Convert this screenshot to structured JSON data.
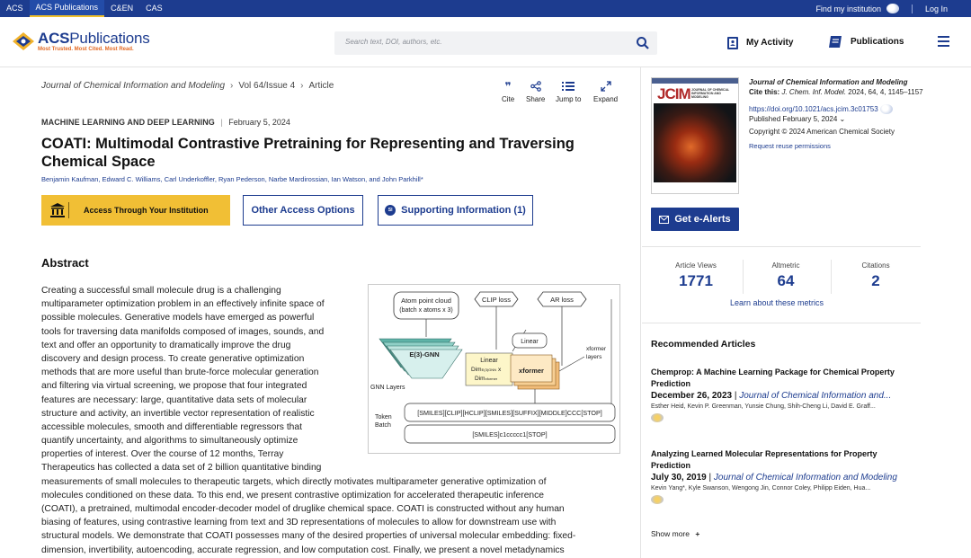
{
  "topbar": {
    "links": [
      "ACS",
      "ACS Publications",
      "C&EN",
      "CAS"
    ],
    "find_institution": "Find my institution",
    "login": "Log In"
  },
  "header": {
    "logo_main": "Publications",
    "logo_prefix": "ACS",
    "logo_tagline": "Most Trusted. Most Cited. Most Read.",
    "search_placeholder": "Search text, DOI, authors, etc.",
    "my_activity": "My Activity",
    "publications": "Publications"
  },
  "breadcrumb": {
    "journal": "Journal of Chemical Information and Modeling",
    "issue": "Vol 64/Issue 4",
    "current": "Article"
  },
  "tools": [
    "Cite",
    "Share",
    "Jump to",
    "Expand"
  ],
  "article": {
    "section": "MACHINE LEARNING AND DEEP LEARNING",
    "date": "February 5, 2024",
    "title": "COATI: Multimodal Contrastive Pretraining for Representing and Traversing Chemical Space",
    "authors": "Benjamin Kaufman,   Edward C. Williams,   Carl Underkoffler,   Ryan Pederson,   Narbe Mardirossian,   Ian Watson,   and  John Parkhill*"
  },
  "buttons": {
    "access": "Access Through Your Institution",
    "other_access": "Other Access Options",
    "supporting": "Supporting Information (1)",
    "si_badge": "SI"
  },
  "abstract": {
    "heading": "Abstract",
    "lines": [
      "Creating a successful small molecule drug is a challenging",
      "multiparameter optimization problem in an effectively infinite space of",
      "possible molecules. Generative models have emerged as powerful",
      "tools for traversing data manifolds composed of images, sounds, and",
      "text and offer an opportunity to dramatically improve the drug",
      "discovery and design process. To create generative optimization",
      "methods that are more useful than brute-force molecular generation",
      "and filtering via virtual screening, we propose that four integrated",
      "features are necessary: large, quantitative data sets of molecular",
      "structure and activity, an invertible vector representation of realistic",
      "accessible molecules, smooth and differentiable regressors that",
      "quantify uncertainty, and algorithms to simultaneously optimize",
      "properties of interest. Over the course of 12 months, Terray",
      "Therapeutics has collected a data set of 2 billion quantitative binding",
      "measurements of small molecules to therapeutic targets, which directly motivates multiparameter generative optimization of",
      "molecules conditioned on these data. To this end, we present contrastive optimization for accelerated therapeutic inference",
      "(COATI), a pretrained, multimodal encoder-decoder model of druglike chemical space. COATI is constructed without any human",
      "biasing of features, using contrastive learning from text and 3D representations of molecules to allow for downstream use with",
      "structural models. We demonstrate that COATI possesses many of the desired properties of universal molecular embedding: fixed-",
      "dimension, invertibility, autoencoding, accurate regression, and low computation cost. Finally, we present a novel metadynamics"
    ]
  },
  "figure": {
    "atom_cloud": "Atom point cloud",
    "atom_cloud_2": "(batch x atoms x 3)",
    "clip_loss": "CLIP loss",
    "ar_loss": "AR loss",
    "egnn": "E(3)-GNN",
    "linear1": "Linear",
    "linear2": "Linear",
    "dim1": "Dim",
    "dim1_sub": "E(3)GNN",
    "dim1_x": "x",
    "dim2": "Dim",
    "dim2_sub": "xformer",
    "xformer": "xformer",
    "xformer_layers": "xformer",
    "xformer_layers2": "layers",
    "gnn_layers": "GNN Layers",
    "token": "Token",
    "batch": "Batch",
    "seq1": "[SMILES][CLIP][HCLIP][SMILES][SUFFIX][MIDDLE]CCC[STOP]",
    "seq2": "[SMILES]c1ccccc1[STOP]"
  },
  "sidebar": {
    "cover_title": "JCIM",
    "cover_sub": "JOURNAL OF CHEMICAL INFORMATION AND MODELING",
    "journal": "Journal of Chemical Information and Modeling",
    "cite_label": "Cite this:",
    "cite_journal": "J. Chem. Inf. Model.",
    "cite_rest": "2024, 64, 4, 1145–1157",
    "doi": "https://doi.org/10.1021/acs.jcim.3c01753",
    "published": "Published February 5, 2024",
    "copyright": "Copyright © 2024 American Chemical Society",
    "reuse": "Request reuse permissions",
    "ealert": "Get e-Alerts"
  },
  "metrics": [
    {
      "label": "Article Views",
      "value": "1771"
    },
    {
      "label": "Altmetric",
      "value": "64"
    },
    {
      "label": "Citations",
      "value": "2"
    }
  ],
  "learn_metrics": "Learn about these metrics",
  "recommended": {
    "heading": "Recommended Articles",
    "items": [
      {
        "title": "Chemprop: A Machine Learning Package for Chemical Property Prediction",
        "date": "December 26, 2023",
        "journal": "Journal of Chemical Information and...",
        "authors": "Esther Heid, Kevin P. Greenman, Yunsie Chung, Shih-Cheng Li, David E. Graff..."
      },
      {
        "title": "Analyzing Learned Molecular Representations for Property Prediction",
        "date": "July 30, 2019",
        "journal": "Journal of Chemical Information and Modeling",
        "authors": "Kevin Yang*, Kyle Swanson, Wengong Jin, Connor Coley, Philipp Eiden, Hua..."
      }
    ],
    "show_more": "Show more"
  },
  "colors": {
    "brand_blue": "#1d3c8f",
    "access_yellow": "#f1bf35",
    "logo_orange": "#e36a24"
  }
}
